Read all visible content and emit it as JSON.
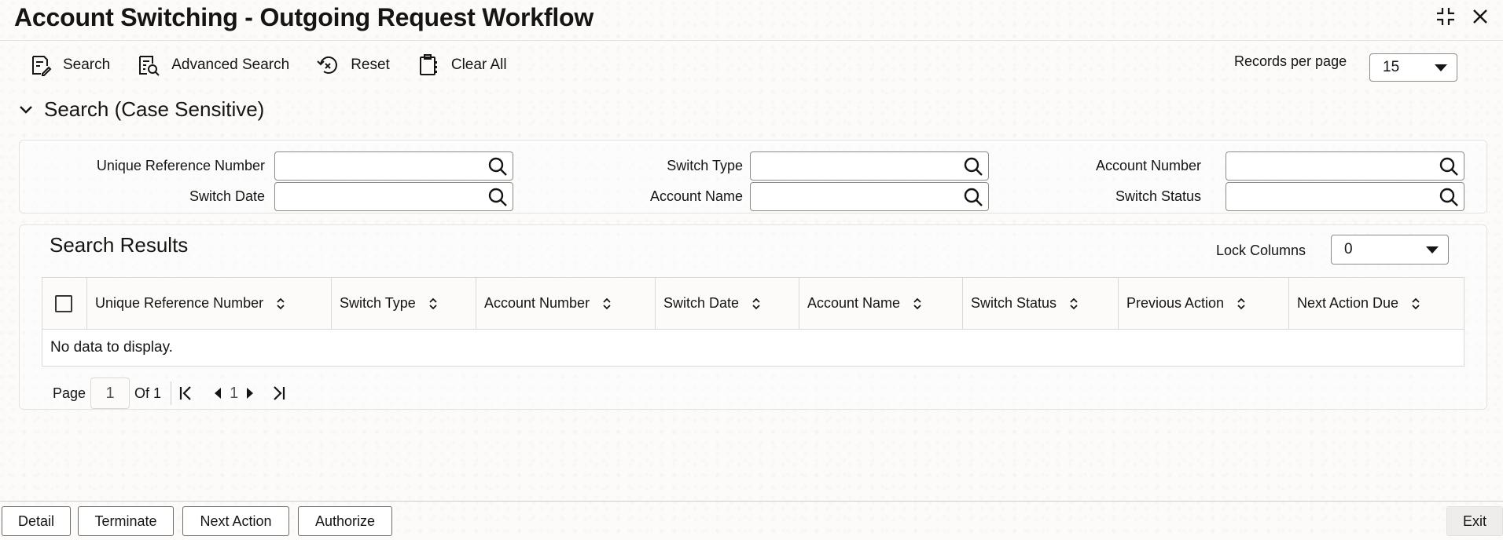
{
  "window": {
    "title": "Account Switching - Outgoing Request Workflow"
  },
  "toolbar": {
    "search": "Search",
    "advanced_search": "Advanced Search",
    "reset": "Reset",
    "clear_all": "Clear All",
    "records_per_page_label": "Records per page",
    "records_per_page_value": "15"
  },
  "search_section": {
    "title": "Search (Case Sensitive)",
    "fields": {
      "unique_reference_number": {
        "label": "Unique Reference Number",
        "value": ""
      },
      "switch_type": {
        "label": "Switch Type",
        "value": ""
      },
      "account_number": {
        "label": "Account Number",
        "value": ""
      },
      "switch_date": {
        "label": "Switch Date",
        "value": ""
      },
      "account_name": {
        "label": "Account Name",
        "value": ""
      },
      "switch_status": {
        "label": "Switch Status",
        "value": ""
      }
    }
  },
  "results": {
    "title": "Search Results",
    "lock_columns_label": "Lock Columns",
    "lock_columns_value": "0",
    "columns": [
      "Unique Reference Number",
      "Switch Type",
      "Account Number",
      "Switch Date",
      "Account Name",
      "Switch Status",
      "Previous Action",
      "Next Action Due"
    ],
    "empty_message": "No data to display.",
    "pager": {
      "page_label": "Page",
      "current_page": "1",
      "of_label": "Of 1",
      "page_number": "1"
    }
  },
  "footer": {
    "detail": "Detail",
    "terminate": "Terminate",
    "next_action": "Next Action",
    "authorize": "Authorize",
    "exit": "Exit"
  },
  "colors": {
    "text": "#161513",
    "border": "#8f8a84",
    "background": "#fcfbfa"
  }
}
